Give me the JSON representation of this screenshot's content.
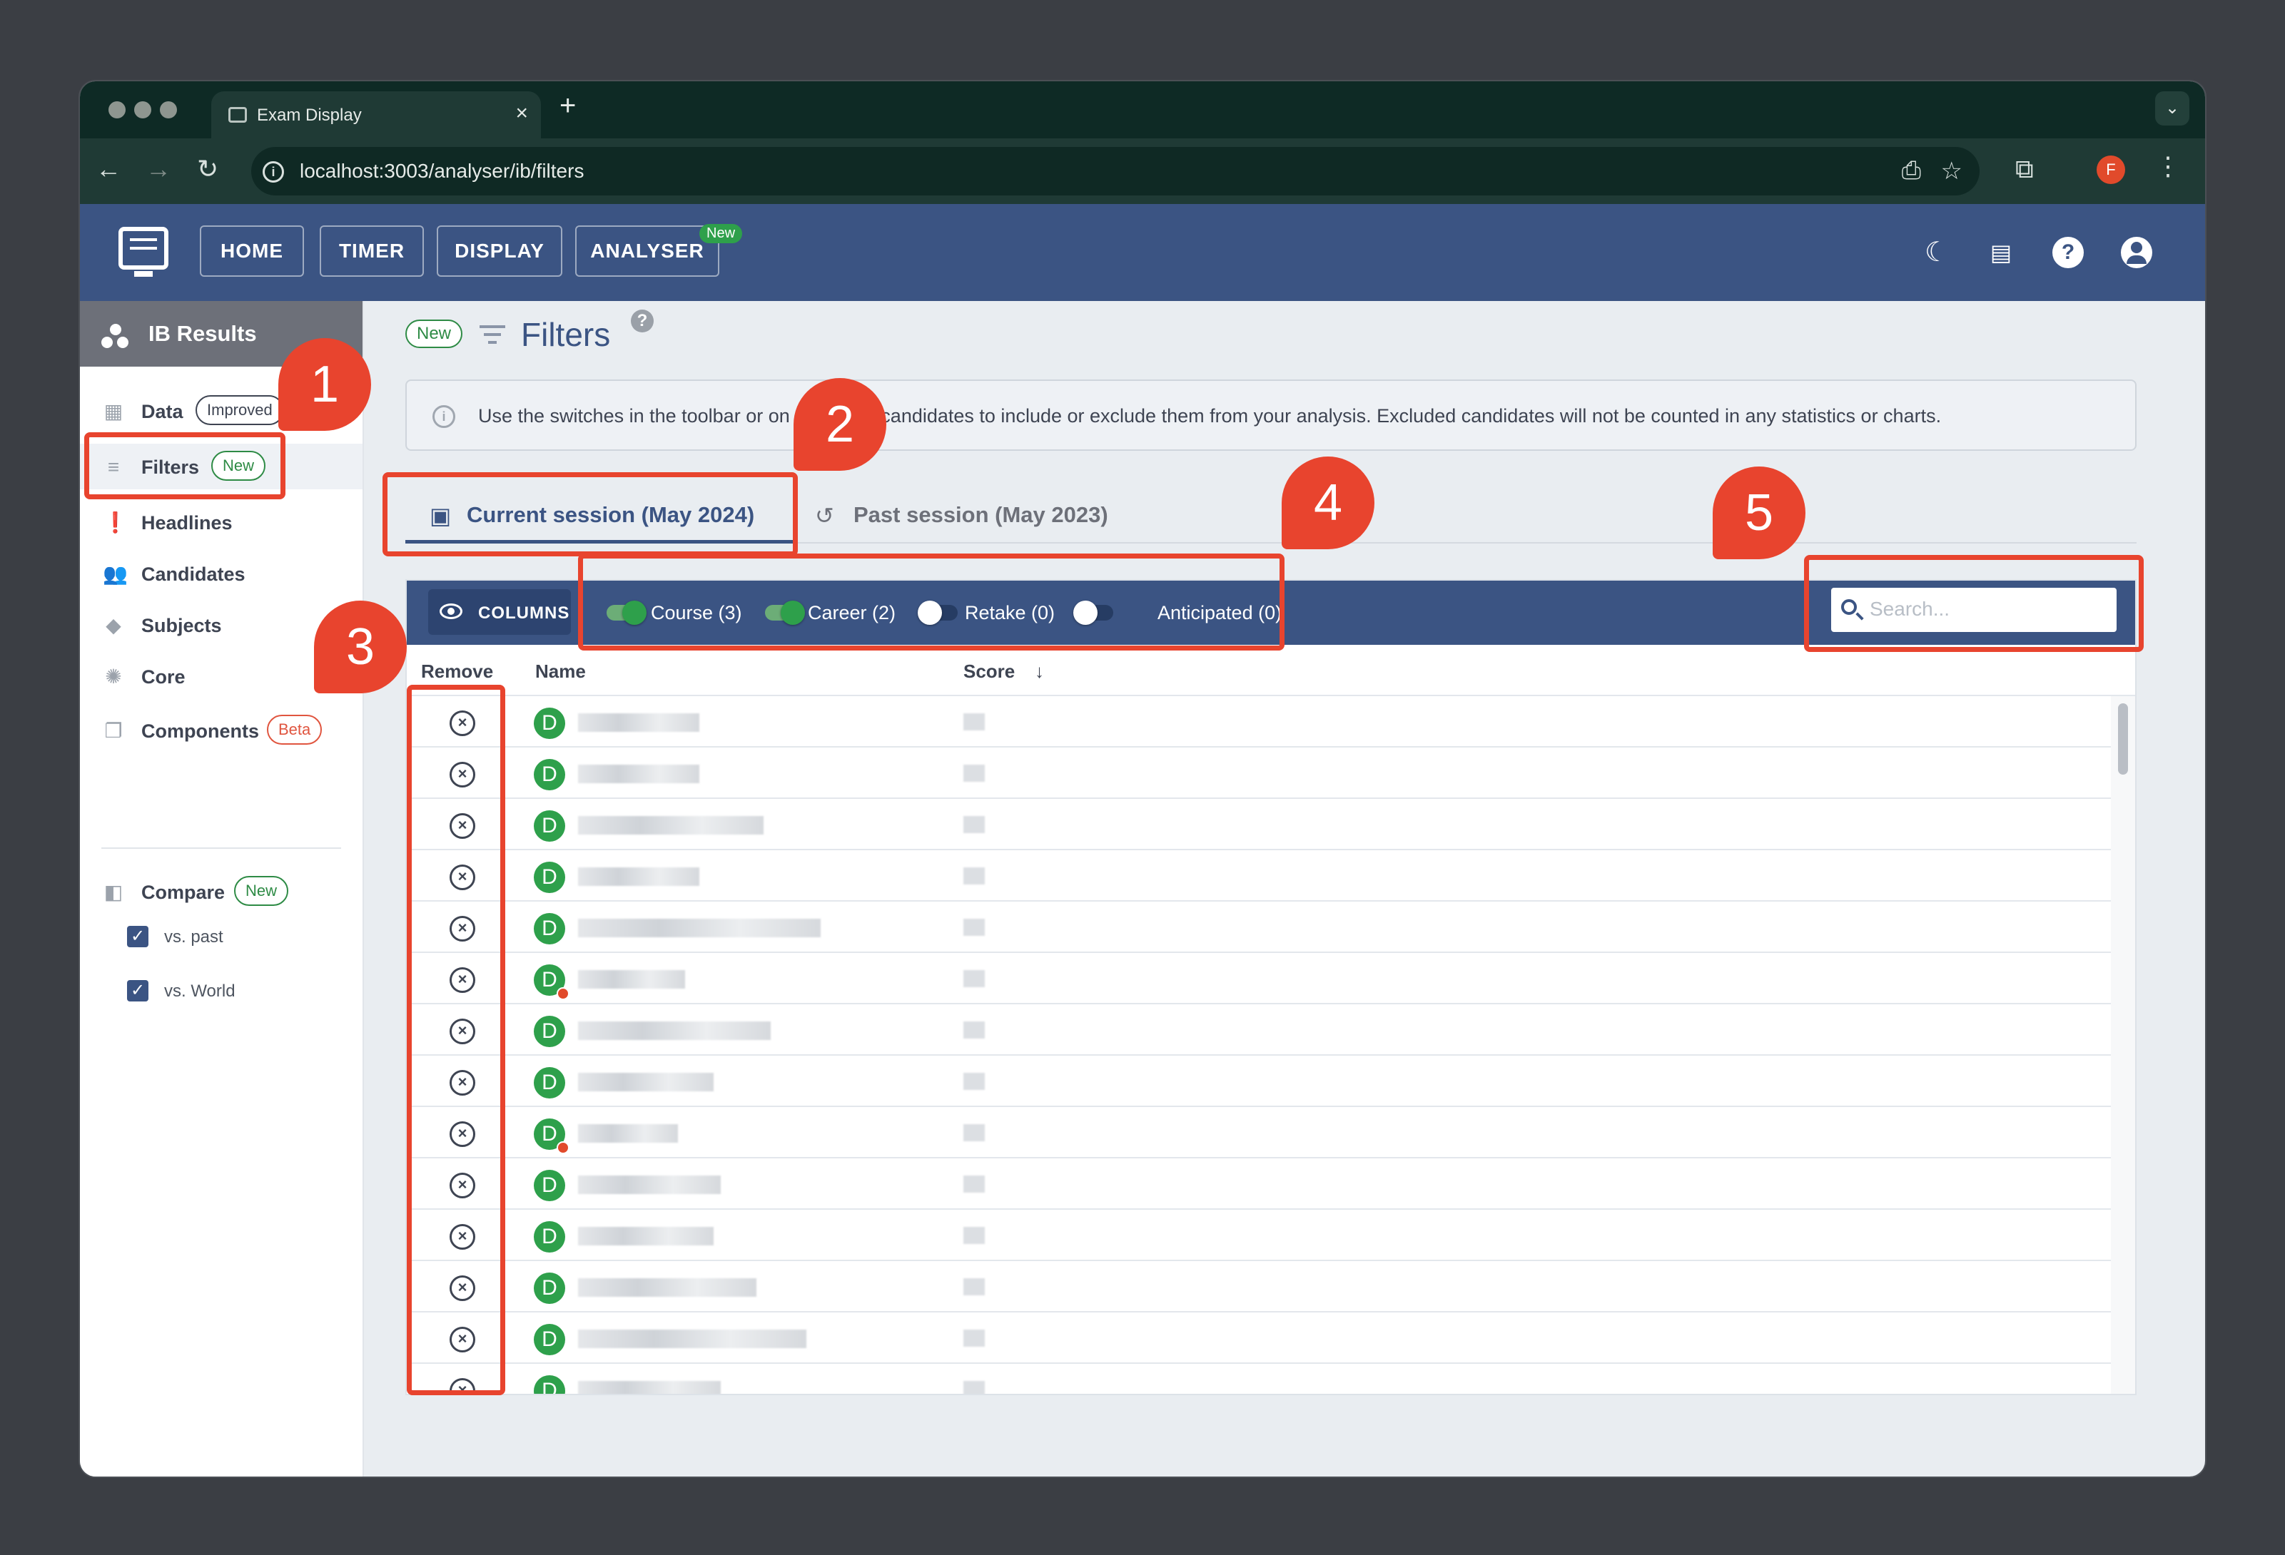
{
  "browser": {
    "tab_title": "Exam Display",
    "tab_close": "×",
    "new_tab": "+",
    "url": "localhost:3003/analyser/ib/filters",
    "profile_initial": "F",
    "icons": [
      "back-icon",
      "forward-icon",
      "reload-icon",
      "install-icon",
      "star-icon",
      "extensions-icon",
      "menu-icon"
    ]
  },
  "header": {
    "nav": [
      {
        "label": "HOME"
      },
      {
        "label": "TIMER"
      },
      {
        "label": "DISPLAY"
      },
      {
        "label": "ANALYSER",
        "badge": "New"
      }
    ],
    "icons": [
      "dark-mode-icon",
      "display-icon",
      "help-icon",
      "account-icon"
    ],
    "help_glyph": "?"
  },
  "sidebar": {
    "title": "IB Results",
    "items": [
      {
        "label": "Data",
        "badge": "Improved",
        "icon": "table-icon"
      },
      {
        "label": "Filters",
        "badge": "New",
        "icon": "filter-icon"
      },
      {
        "label": "Headlines",
        "icon": "headline-icon"
      },
      {
        "label": "Candidates",
        "icon": "people-icon"
      },
      {
        "label": "Subjects",
        "icon": "subjects-icon"
      },
      {
        "label": "Core",
        "icon": "core-icon"
      },
      {
        "label": "Components",
        "badge": "Beta",
        "icon": "components-icon"
      }
    ],
    "compare": {
      "label": "Compare",
      "badge": "New",
      "options": [
        {
          "label": "vs. past",
          "checked": true
        },
        {
          "label": "vs. World",
          "checked": true
        }
      ]
    }
  },
  "page": {
    "badge": "New",
    "title": "Filters",
    "help_glyph": "?",
    "info": "Use the switches in the toolbar or on individual candidates to include or exclude them from your analysis. Excluded candidates will not be counted in any statistics or charts.",
    "info_glyph": "i",
    "tabs": [
      {
        "label": "Current session (May 2024)",
        "active": true
      },
      {
        "label": "Past session (May 2023)",
        "active": false
      }
    ]
  },
  "grid": {
    "columns_button": "COLUMNS",
    "toggles": [
      {
        "label": "Course (3)",
        "on": true
      },
      {
        "label": "Career (2)",
        "on": true
      },
      {
        "label": "Retake (0)",
        "on": false
      },
      {
        "label": "Anticipated (0)",
        "on": false
      }
    ],
    "search_placeholder": "Search...",
    "headers": {
      "remove": "Remove",
      "name": "Name",
      "score": "Score",
      "sort_glyph": "↓"
    },
    "remove_glyph": "×",
    "avatar_letter": "D",
    "rows": [
      {
        "globe": false
      },
      {
        "globe": false
      },
      {
        "globe": false
      },
      {
        "globe": false
      },
      {
        "globe": false
      },
      {
        "globe": true
      },
      {
        "globe": false
      },
      {
        "globe": false
      },
      {
        "globe": true
      },
      {
        "globe": false
      },
      {
        "globe": false
      },
      {
        "globe": false
      },
      {
        "globe": false
      },
      {
        "globe": false
      }
    ]
  },
  "annotations": [
    {
      "number": "1",
      "target": "filters-sidebar-item"
    },
    {
      "number": "2",
      "target": "current-session-tab"
    },
    {
      "number": "3",
      "target": "remove-column"
    },
    {
      "number": "4",
      "target": "toolbar-toggles"
    },
    {
      "number": "5",
      "target": "search-box"
    }
  ],
  "colors": {
    "accent": "#3b5483",
    "annotation": "#e8442e",
    "success": "#2ea04b"
  }
}
